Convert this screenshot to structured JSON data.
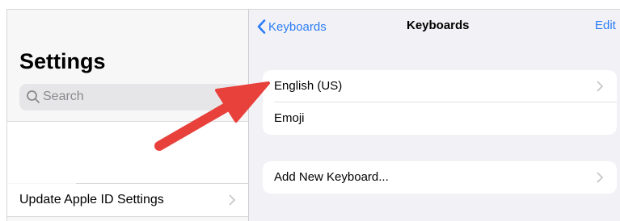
{
  "sidebar": {
    "title": "Settings",
    "search_placeholder": "Search",
    "items": [
      {
        "label": "Update Apple ID Settings"
      }
    ]
  },
  "detail": {
    "nav": {
      "back_label": "Keyboards",
      "title": "Keyboards",
      "edit_label": "Edit"
    },
    "keyboards": [
      {
        "label": "English (US)",
        "chevron": true
      },
      {
        "label": "Emoji",
        "chevron": false
      }
    ],
    "add_keyboard": {
      "label": "Add New Keyboard...",
      "chevron": true
    }
  },
  "colors": {
    "accent": "#2b7cf6",
    "annotation_arrow": "#e8413c",
    "grouped_background": "#f2f2f6"
  },
  "icons": {
    "search": "magnifying-glass-icon",
    "mic": "microphone-icon",
    "back": "chevron-left-icon",
    "disclosure": "chevron-right-icon",
    "annotation": "red-arrow-icon"
  }
}
